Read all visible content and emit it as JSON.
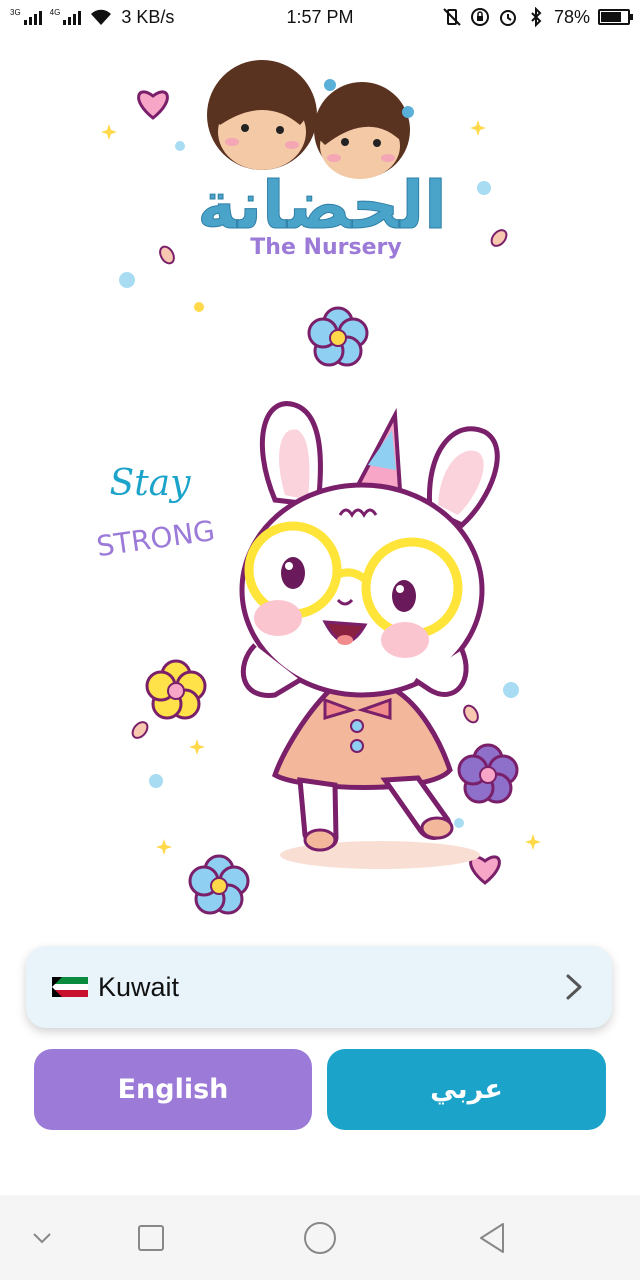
{
  "status_bar": {
    "net_tag_1": "3G",
    "net_tag_2": "4G",
    "speed": "3 KB/s",
    "time": "1:57 PM",
    "battery_percent": "78%",
    "battery_level": 0.78
  },
  "logo": {
    "arabic_title": "الحضانة",
    "english_title": "The Nursery"
  },
  "illustration": {
    "stay_text": "Stay",
    "strong_text": "STRONG"
  },
  "country_selector": {
    "flag_icon": "kuwait-flag-icon",
    "country": "Kuwait",
    "chevron_icon": "chevron-right-icon"
  },
  "language_buttons": {
    "english_label": "English",
    "arabic_label": "عربي",
    "english_color": "#9b7ad8",
    "arabic_color": "#1ba3c9"
  },
  "nav_bar": {
    "icons": [
      "chevron-down-icon",
      "recents-square-icon",
      "home-circle-icon",
      "back-triangle-icon"
    ]
  }
}
